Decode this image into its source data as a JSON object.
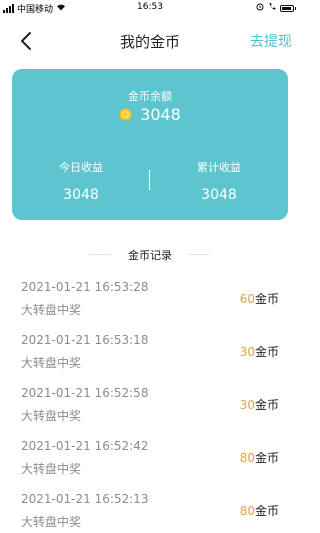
{
  "status_bar": {
    "carrier": "中国移动",
    "time": "16:53",
    "right_icons": [
      "alarm-icon",
      "phone-icon",
      "battery-icon"
    ]
  },
  "nav": {
    "title": "我的金币",
    "action_label": "去提现",
    "back_icon": "chevron-left-icon"
  },
  "colors": {
    "card": "#5cc5cf",
    "accent_link": "#52c0cc",
    "amount": "#e6a23c",
    "coin": "#f5c518"
  },
  "balance_card": {
    "label": "金币余额",
    "balance": "3048",
    "today": {
      "label": "今日收益",
      "value": "3048"
    },
    "total": {
      "label": "累计收益",
      "value": "3048"
    }
  },
  "records": {
    "title": "金币记录",
    "unit": "金币",
    "items": [
      {
        "time": "2021-01-21 16:53:28",
        "desc": "大转盘中奖",
        "amount": "60"
      },
      {
        "time": "2021-01-21 16:53:18",
        "desc": "大转盘中奖",
        "amount": "30"
      },
      {
        "time": "2021-01-21 16:52:58",
        "desc": "大转盘中奖",
        "amount": "30"
      },
      {
        "time": "2021-01-21 16:52:42",
        "desc": "大转盘中奖",
        "amount": "80"
      },
      {
        "time": "2021-01-21 16:52:13",
        "desc": "大转盘中奖",
        "amount": "80"
      }
    ]
  }
}
